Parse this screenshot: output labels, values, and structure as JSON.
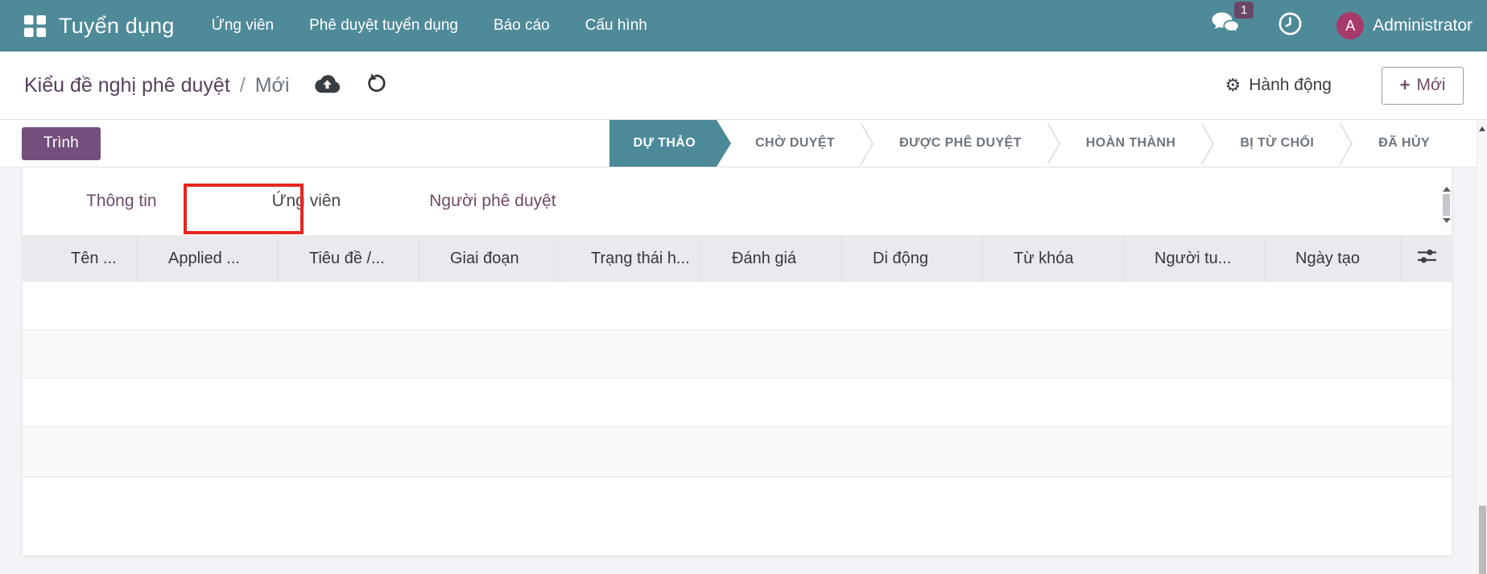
{
  "navbar": {
    "app_name": "Tuyển dụng",
    "menu_items": [
      {
        "label": "Ứng viên"
      },
      {
        "label": "Phê duyệt tuyển dụng"
      },
      {
        "label": "Báo cáo"
      },
      {
        "label": "Cấu hình"
      }
    ],
    "messages_badge": "1",
    "user_initial": "A",
    "user_name": "Administrator"
  },
  "breadcrumb": {
    "parent": "Kiểu đề nghị phê duyệt",
    "separator": "/",
    "current": "Mới"
  },
  "actions": {
    "action_menu_label": "Hành động",
    "gear_glyph": "⚙",
    "new_plus_glyph": "+",
    "new_button_label": "Mới"
  },
  "statusbar": {
    "submit_button_label": "Trình",
    "active_step": "DỰ THẢO",
    "steps": [
      {
        "label": "DỰ THẢO",
        "active": true
      },
      {
        "label": "CHỜ DUYỆT",
        "active": false
      },
      {
        "label": "ĐƯỢC PHÊ DUYỆT",
        "active": false
      },
      {
        "label": "HOÀN THÀNH",
        "active": false
      },
      {
        "label": "BỊ TỪ CHỐI",
        "active": false
      },
      {
        "label": "ĐÃ HỦY",
        "active": false
      }
    ]
  },
  "tabs": [
    {
      "label": "Thông tin",
      "active": false
    },
    {
      "label": "Ứng viên",
      "active": true,
      "annotated": true
    },
    {
      "label": "Người phê duyệt",
      "active": false
    }
  ],
  "table": {
    "columns": [
      "Tên ...",
      "Applied ...",
      "Tiêu đề /...",
      "Giai đoạn",
      "Trạng thái h...",
      "Đánh giá",
      "Di động",
      "Từ khóa",
      "Người tu...",
      "Ngày tạo"
    ],
    "rows": []
  },
  "icons": {
    "apps": "grid",
    "messages": "chat-bubbles",
    "activities": "clock",
    "save": "cloud-upload",
    "discard": "undo",
    "action_menu": "gear",
    "optional_columns": "sliders"
  },
  "colors": {
    "topbar_teal": "#4f8a98",
    "active_step_teal": "#4c8a9a",
    "primary_purple": "#744e7c",
    "link_purple": "#6e4b68",
    "avatar_pink": "#a73a6a",
    "annotation_red": "#e8251f",
    "header_gray": "#e9eaed",
    "stripe_gray": "#f8f9fa"
  }
}
